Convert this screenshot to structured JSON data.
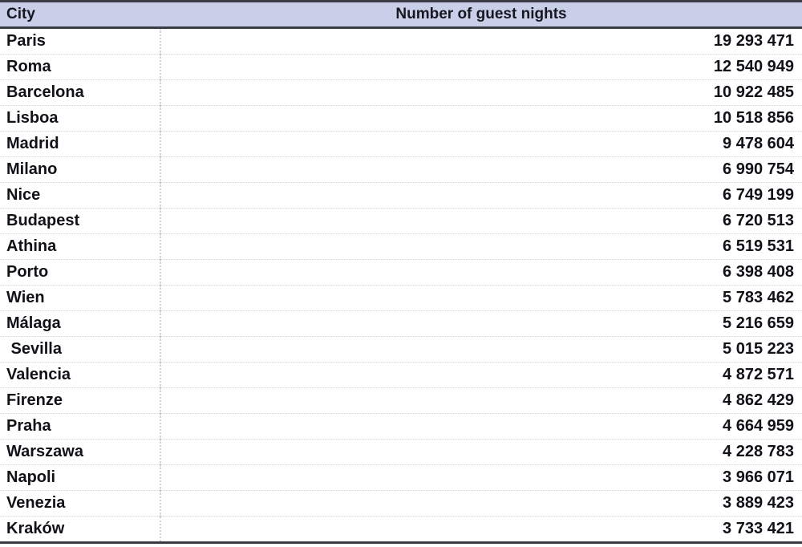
{
  "table": {
    "columns": [
      {
        "key": "city",
        "label": "City",
        "align": "left"
      },
      {
        "key": "nights",
        "label": "Number of guest nights",
        "align": "center"
      }
    ],
    "header": {
      "city_label": "City",
      "nights_label": "Number of guest nights",
      "background_color": "#c9cfe8",
      "text_color": "#17171f",
      "border_color": "#3b3b46"
    },
    "gridline_color": "#d3d3d8",
    "row_count": 20,
    "rows": [
      {
        "city": "Paris",
        "nights": "19 293 471"
      },
      {
        "city": "Roma",
        "nights": "12 540 949"
      },
      {
        "city": "Barcelona",
        "nights": "10 922 485"
      },
      {
        "city": "Lisboa",
        "nights": "10 518 856"
      },
      {
        "city": "Madrid",
        "nights": "9 478 604"
      },
      {
        "city": "Milano",
        "nights": "6 990 754"
      },
      {
        "city": "Nice",
        "nights": "6 749 199"
      },
      {
        "city": "Budapest",
        "nights": "6 720 513"
      },
      {
        "city": "Athina",
        "nights": "6 519 531"
      },
      {
        "city": "Porto",
        "nights": "6 398 408"
      },
      {
        "city": "Wien",
        "nights": "5 783 462"
      },
      {
        "city": "Málaga",
        "nights": "5 216 659"
      },
      {
        "city": " Sevilla",
        "nights": "5 015 223"
      },
      {
        "city": "Valencia",
        "nights": "4 872 571"
      },
      {
        "city": "Firenze",
        "nights": "4 862 429"
      },
      {
        "city": "Praha",
        "nights": "4 664 959"
      },
      {
        "city": "Warszawa",
        "nights": "4 228 783"
      },
      {
        "city": "Napoli",
        "nights": "3 966 071"
      },
      {
        "city": "Venezia",
        "nights": "3 889 423"
      },
      {
        "city": "Kraków",
        "nights": "3 733 421"
      }
    ]
  },
  "chart_data": {
    "type": "table",
    "title": "Number of guest nights",
    "xlabel": "City",
    "ylabel": "Number of guest nights",
    "categories": [
      "Paris",
      "Roma",
      "Barcelona",
      "Lisboa",
      "Madrid",
      "Milano",
      "Nice",
      "Budapest",
      "Athina",
      "Porto",
      "Wien",
      "Málaga",
      "Sevilla",
      "Valencia",
      "Firenze",
      "Praha",
      "Warszawa",
      "Napoli",
      "Venezia",
      "Kraków"
    ],
    "values": [
      19293471,
      12540949,
      10922485,
      10518856,
      9478604,
      6990754,
      6749199,
      6720513,
      6519531,
      6398408,
      5783462,
      5216659,
      5015223,
      4872571,
      4862429,
      4664959,
      4228783,
      3966071,
      3889423,
      3733421
    ],
    "value_labels": [
      "19 293 471",
      "12 540 949",
      "10 922 485",
      "10 518 856",
      "9 478 604",
      "6 990 754",
      "6 749 199",
      "6 720 513",
      "6 519 531",
      "6 398 408",
      "5 783 462",
      "5 216 659",
      "5 015 223",
      "4 872 571",
      "4 862 429",
      "4 664 959",
      "4 228 783",
      "3 966 071",
      "3 889 423",
      "3 733 421"
    ],
    "thousands_separator": " ",
    "sort_order": "descending",
    "grid": true,
    "legend": "none"
  }
}
